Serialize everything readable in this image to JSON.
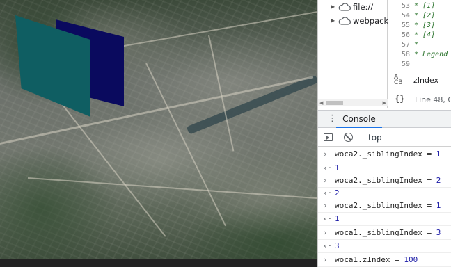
{
  "sources": {
    "tree": [
      {
        "label": "file://"
      },
      {
        "label": "webpack:/"
      }
    ],
    "code_lines": [
      {
        "line": "53",
        "text": "* [1]"
      },
      {
        "line": "54",
        "text": "* [2]"
      },
      {
        "line": "55",
        "text": "* [3]"
      },
      {
        "line": "56",
        "text": "* [4]"
      },
      {
        "line": "57",
        "text": "*"
      },
      {
        "line": "58",
        "text": "* Legend"
      },
      {
        "line": "59",
        "text": ""
      }
    ],
    "search": {
      "value": "zIndex",
      "icon_text_top": "A",
      "icon_text_bottom": "CB"
    },
    "status": {
      "braces": "{}",
      "position": "Line 48, C"
    }
  },
  "drawer": {
    "tab": "Console"
  },
  "console": {
    "context": "top",
    "entries": [
      {
        "kind": "input",
        "expr": "woca2._siblingIndex = ",
        "value": "1"
      },
      {
        "kind": "result",
        "value": "1"
      },
      {
        "kind": "input",
        "expr": "woca2._siblingIndex = ",
        "value": "2"
      },
      {
        "kind": "result",
        "value": "2"
      },
      {
        "kind": "input",
        "expr": "woca2._siblingIndex = ",
        "value": "1"
      },
      {
        "kind": "result",
        "value": "1"
      },
      {
        "kind": "input",
        "expr": "woca1._siblingIndex = ",
        "value": "3"
      },
      {
        "kind": "result",
        "value": "3"
      },
      {
        "kind": "input",
        "expr": "woca1.zIndex = ",
        "value": "100"
      }
    ]
  },
  "scene": {
    "panels": [
      {
        "name": "teal-panel",
        "color": "#0f5e62"
      },
      {
        "name": "navy-panel",
        "color": "#0a0a5e"
      }
    ]
  }
}
